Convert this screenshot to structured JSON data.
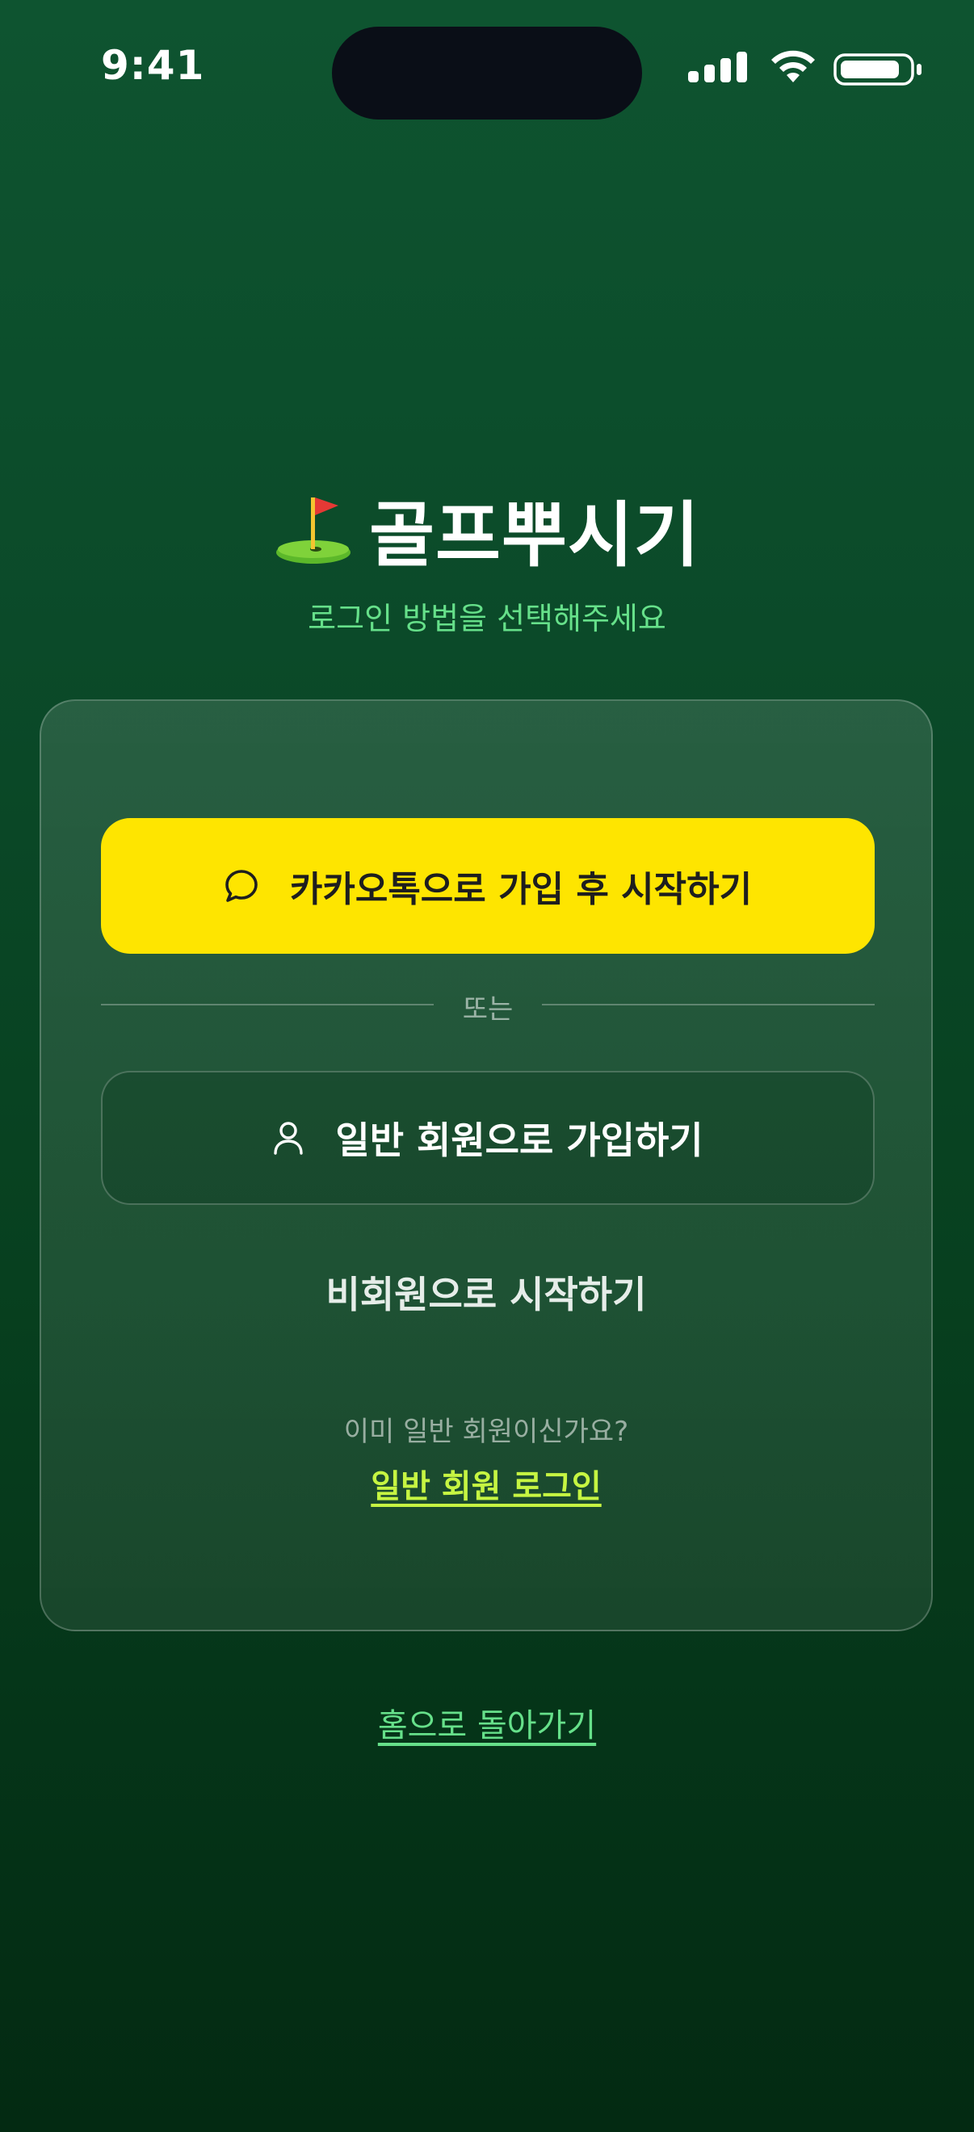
{
  "status_bar": {
    "time": "9:41",
    "icons": [
      "signal-icon",
      "wifi-icon",
      "battery-icon"
    ]
  },
  "header": {
    "icon": "golf-flag-icon",
    "title": "골프뿌시기",
    "subtitle": "로그인 방법을 선택해주세요"
  },
  "card": {
    "kakao_button": {
      "icon": "chat-bubble-icon",
      "label": "카카오톡으로 가입 후 시작하기"
    },
    "divider_text": "또는",
    "member_button": {
      "icon": "user-icon",
      "label": "일반 회원으로 가입하기"
    },
    "guest_button_label": "비회원으로 시작하기",
    "already_member_text": "이미 일반 회원이신가요?",
    "member_login_link": "일반 회원 로그인"
  },
  "home_link": "홈으로 돌아가기",
  "colors": {
    "background_top": "#0e5430",
    "background_bottom": "#032a12",
    "kakao_yellow": "#fee500",
    "accent_green": "#66e08a",
    "link_lime": "#c6f542"
  }
}
